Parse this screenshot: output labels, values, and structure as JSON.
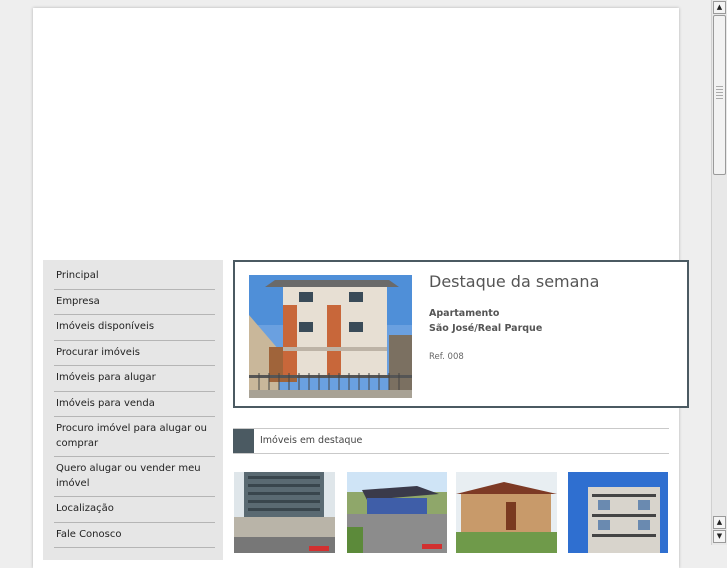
{
  "nav": {
    "items": [
      "Principal",
      "Empresa",
      "Imóveis disponíveis",
      "Procurar imóveis",
      "Imóveis para alugar",
      "Imóveis para venda",
      "Procuro imóvel para alugar ou comprar",
      "Quero alugar ou vender meu imóvel",
      "Localização",
      "Fale Conosco"
    ]
  },
  "featured": {
    "title": "Destaque da semana",
    "type": "Apartamento",
    "location": "São José/Real Parque",
    "ref": "Ref. 008"
  },
  "section": {
    "title": "Imóveis em destaque"
  },
  "icons": {
    "scroll_up": "arrow-up-icon",
    "scroll_down": "arrow-down-icon"
  },
  "colors": {
    "accent": "#4b5a62",
    "sidebar_bg": "#e6e6e6"
  }
}
